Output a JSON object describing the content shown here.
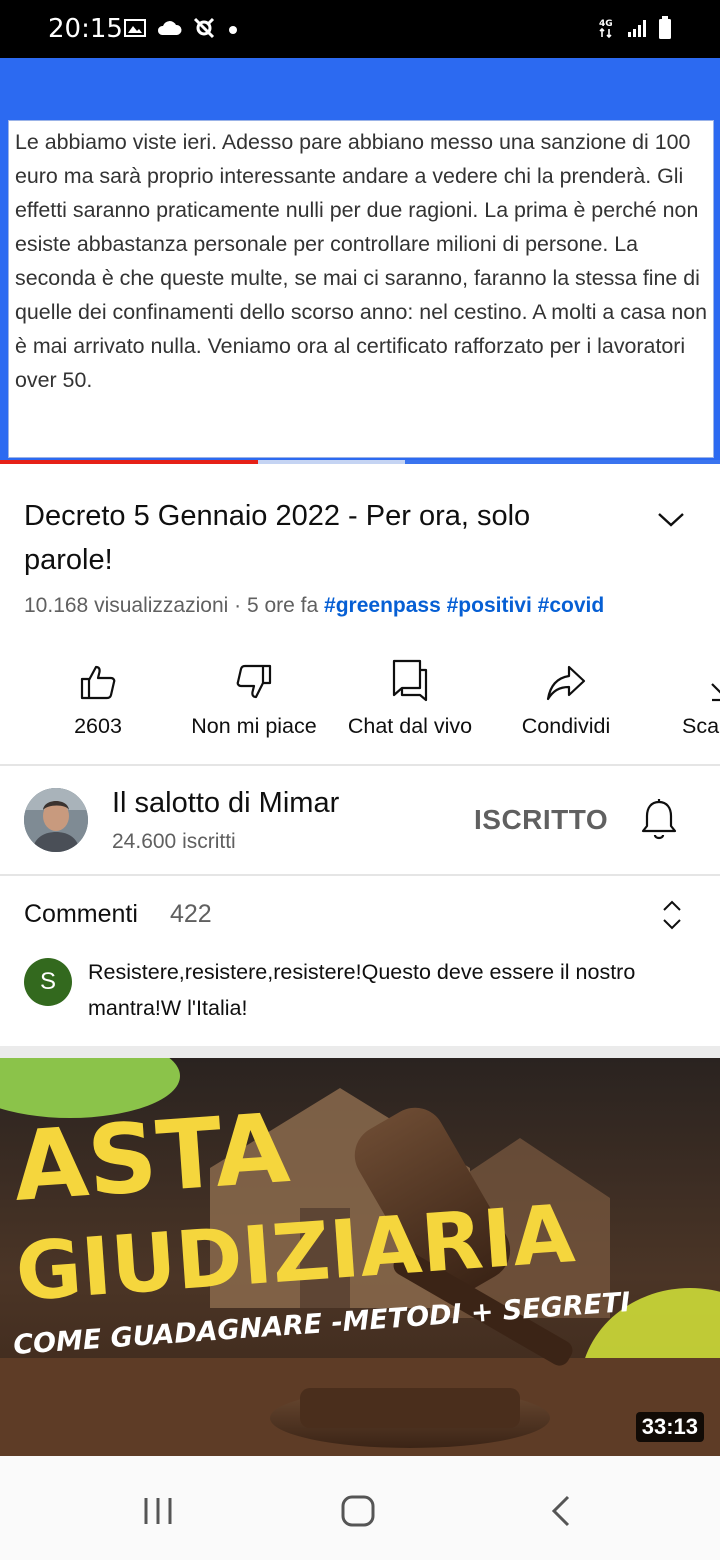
{
  "status_bar": {
    "time": "20:15",
    "icons_left": [
      "image-icon",
      "cloud-icon",
      "tool-icon",
      "dot-icon"
    ],
    "icons_right": [
      "4g-icon",
      "signal-icon",
      "battery-icon"
    ]
  },
  "player": {
    "caption_text": "Le abbiamo viste ieri. Adesso pare abbiano messo una sanzione di 100 euro ma sarà proprio interessante andare a vedere chi la prenderà. Gli effetti saranno praticamente nulli per due ragioni. La prima è perché non esiste abbastanza personale per controllare milioni di persone. La seconda è che queste multe, se mai ci saranno, faranno la stessa fine di quelle dei confinamenti dello scorso anno: nel cestino. A molti a casa non è mai arrivato nulla. Veniamo ora al certificato rafforzato per i lavoratori over 50.",
    "progress_played": 0.358,
    "progress_buffered": 0.5625,
    "colors": {
      "background": "#2c6af1",
      "played": "#e62117"
    }
  },
  "video": {
    "title": "Decreto 5 Gennaio 2022 - Per ora, solo parole!",
    "views": "10.168 visualizzazioni",
    "age": "5 ore fa",
    "hashtags": [
      "#greenpass",
      "#positivi",
      "#covid"
    ]
  },
  "actions": [
    {
      "label": "2603",
      "icon": "thumbs-up-icon"
    },
    {
      "label": "Non mi piace",
      "icon": "thumbs-down-icon"
    },
    {
      "label": "Chat dal vivo",
      "icon": "live-chat-icon"
    },
    {
      "label": "Condividi",
      "icon": "share-icon"
    },
    {
      "label": "Sca",
      "icon": "download-icon"
    }
  ],
  "channel": {
    "name": "Il salotto di Mimar",
    "subscribers": "24.600 iscritti",
    "subscribe_state": "ISCRITTO"
  },
  "comments": {
    "title": "Commenti",
    "count": "422",
    "top_comment": {
      "avatar_letter": "S",
      "avatar_color": "#33691e",
      "text": "Resistere,resistere,resistere!Questo deve essere il nostro mantra!W l'Italia!"
    }
  },
  "next_video": {
    "thumbnail_line1": "ASTA",
    "thumbnail_line2": "GIUDIZIARIA",
    "thumbnail_line3": "COME GUADAGNARE -METODI + SEGRETI",
    "duration": "33:13",
    "accent_color": "#f5d63d"
  },
  "nav_bar": {
    "buttons": [
      "recent-apps-icon",
      "home-icon",
      "back-icon"
    ]
  }
}
